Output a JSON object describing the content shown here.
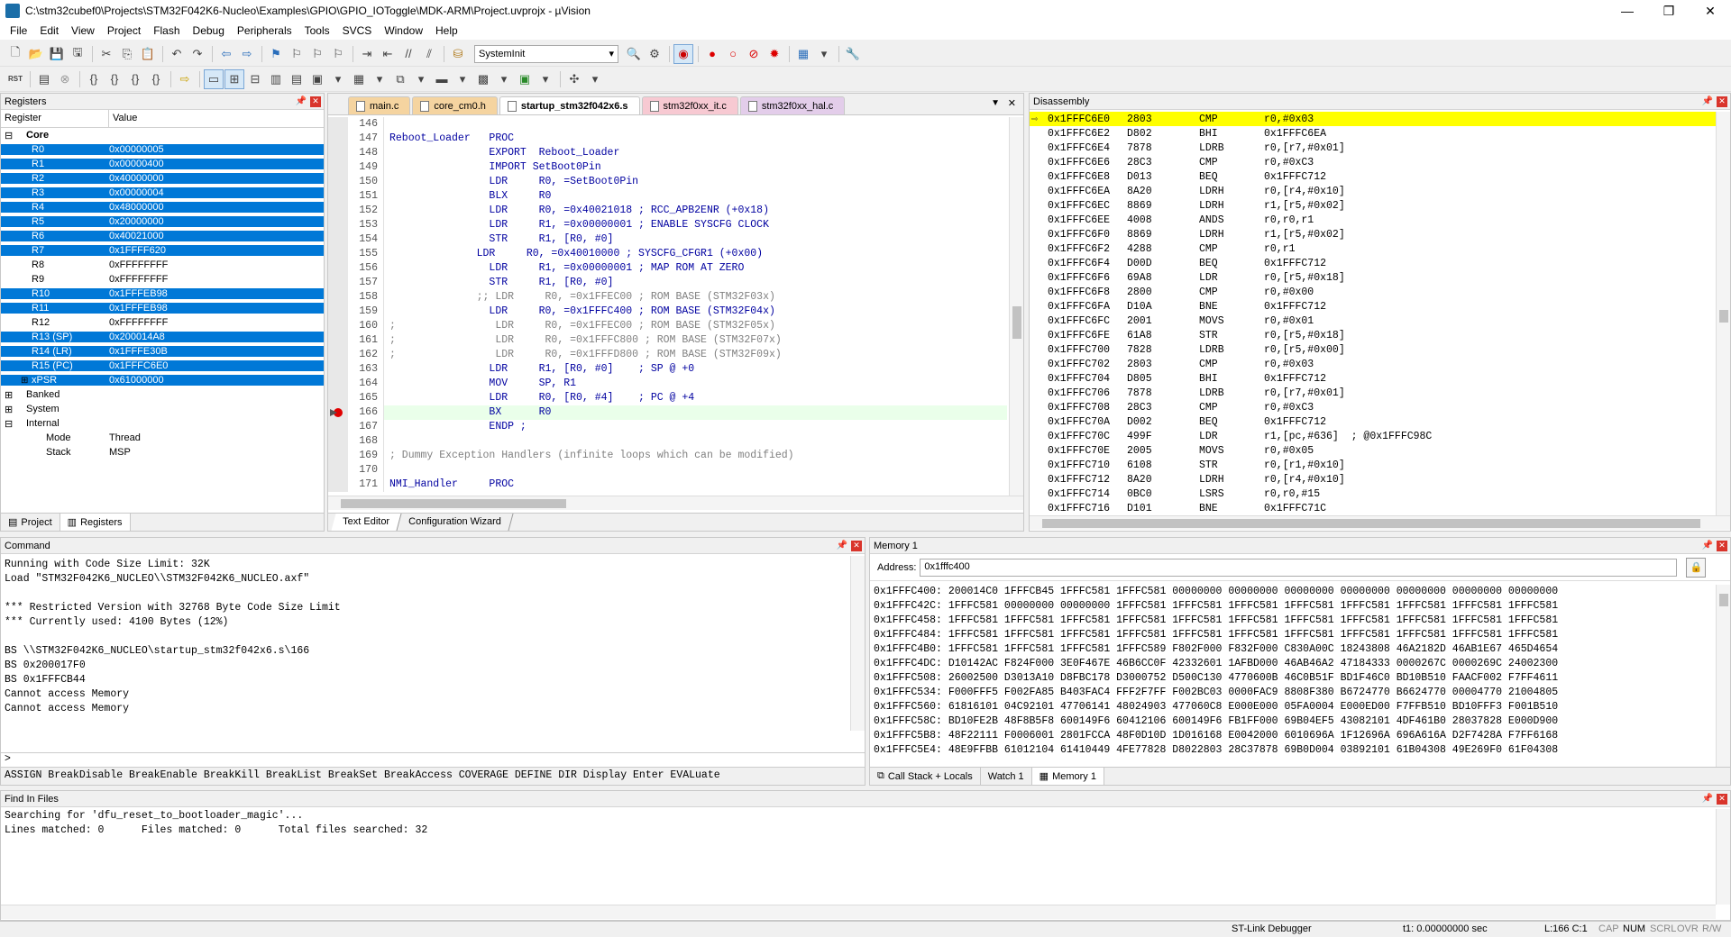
{
  "window": {
    "title": "C:\\stm32cubef0\\Projects\\STM32F042K6-Nucleo\\Examples\\GPIO\\GPIO_IOToggle\\MDK-ARM\\Project.uvprojx - µVision",
    "minimize": "—",
    "maximize": "❐",
    "close": "✕"
  },
  "menu": [
    "File",
    "Edit",
    "View",
    "Project",
    "Flash",
    "Debug",
    "Peripherals",
    "Tools",
    "SVCS",
    "Window",
    "Help"
  ],
  "toolbar": {
    "target_combo": "SystemInit"
  },
  "registers": {
    "title": "Registers",
    "col_register": "Register",
    "col_value": "Value",
    "core_label": "Core",
    "rows": [
      {
        "name": "R0",
        "value": "0x00000005",
        "sel": true
      },
      {
        "name": "R1",
        "value": "0x00000400",
        "sel": true
      },
      {
        "name": "R2",
        "value": "0x40000000",
        "sel": true
      },
      {
        "name": "R3",
        "value": "0x00000004",
        "sel": true
      },
      {
        "name": "R4",
        "value": "0x48000000",
        "sel": true
      },
      {
        "name": "R5",
        "value": "0x20000000",
        "sel": true
      },
      {
        "name": "R6",
        "value": "0x40021000",
        "sel": true
      },
      {
        "name": "R7",
        "value": "0x1FFFF620",
        "sel": true
      },
      {
        "name": "R8",
        "value": "0xFFFFFFFF",
        "sel": false
      },
      {
        "name": "R9",
        "value": "0xFFFFFFFF",
        "sel": false
      },
      {
        "name": "R10",
        "value": "0x1FFFEB98",
        "sel": true
      },
      {
        "name": "R11",
        "value": "0x1FFFEB98",
        "sel": true
      },
      {
        "name": "R12",
        "value": "0xFFFFFFFF",
        "sel": false
      },
      {
        "name": "R13 (SP)",
        "value": "0x200014A8",
        "sel": true
      },
      {
        "name": "R14 (LR)",
        "value": "0x1FFFE30B",
        "sel": true
      },
      {
        "name": "R15 (PC)",
        "value": "0x1FFFC6E0",
        "sel": true
      },
      {
        "name": "xPSR",
        "value": "0x61000000",
        "sel": true
      }
    ],
    "banked": "Banked",
    "system": "System",
    "internal": "Internal",
    "mode_label": "Mode",
    "mode_value": "Thread",
    "stack_label": "Stack",
    "stack_value": "MSP",
    "tab_project": "Project",
    "tab_registers": "Registers"
  },
  "editor": {
    "tabs": [
      {
        "label": "main.c",
        "color": "#f5d4a0",
        "active": false
      },
      {
        "label": "core_cm0.h",
        "color": "#f5d4a0",
        "active": false
      },
      {
        "label": "startup_stm32f042x6.s",
        "color": "#f0f0f0",
        "active": true
      },
      {
        "label": "stm32f0xx_it.c",
        "color": "#f7c9d2",
        "active": false
      },
      {
        "label": "stm32f0xx_hal.c",
        "color": "#e3cdea",
        "active": false
      }
    ],
    "lines": [
      {
        "n": "146",
        "t": ""
      },
      {
        "n": "147",
        "t": "Reboot_Loader   PROC"
      },
      {
        "n": "148",
        "t": "                EXPORT  Reboot_Loader"
      },
      {
        "n": "149",
        "t": "                IMPORT SetBoot0Pin"
      },
      {
        "n": "150",
        "t": "                LDR     R0, =SetBoot0Pin"
      },
      {
        "n": "151",
        "t": "                BLX     R0"
      },
      {
        "n": "152",
        "t": "                LDR     R0, =0x40021018 ; RCC_APB2ENR (+0x18)"
      },
      {
        "n": "153",
        "t": "                LDR     R1, =0x00000001 ; ENABLE SYSCFG CLOCK"
      },
      {
        "n": "154",
        "t": "                STR     R1, [R0, #0]"
      },
      {
        "n": "155",
        "t": "              LDR     R0, =0x40010000 ; SYSCFG_CFGR1 (+0x00)"
      },
      {
        "n": "156",
        "t": "                LDR     R1, =0x00000001 ; MAP ROM AT ZERO"
      },
      {
        "n": "157",
        "t": "                STR     R1, [R0, #0]"
      },
      {
        "n": "158",
        "t": "              ;; LDR     R0, =0x1FFEC00 ; ROM BASE (STM32F03x)"
      },
      {
        "n": "159",
        "t": "                LDR     R0, =0x1FFFC400 ; ROM BASE (STM32F04x)"
      },
      {
        "n": "160",
        "t": ";                LDR     R0, =0x1FFEC00 ; ROM BASE (STM32F05x)"
      },
      {
        "n": "161",
        "t": ";                LDR     R0, =0x1FFFC800 ; ROM BASE (STM32F07x)"
      },
      {
        "n": "162",
        "t": ";                LDR     R0, =0x1FFFD800 ; ROM BASE (STM32F09x)"
      },
      {
        "n": "163",
        "t": "                LDR     R1, [R0, #0]    ; SP @ +0"
      },
      {
        "n": "164",
        "t": "                MOV     SP, R1"
      },
      {
        "n": "165",
        "t": "                LDR     R0, [R0, #4]    ; PC @ +4"
      },
      {
        "n": "166",
        "t": "                BX      R0"
      },
      {
        "n": "167",
        "t": "                ENDP ;"
      },
      {
        "n": "168",
        "t": ""
      },
      {
        "n": "169",
        "t": "; Dummy Exception Handlers (infinite loops which can be modified)"
      },
      {
        "n": "170",
        "t": ""
      },
      {
        "n": "171",
        "t": "NMI_Handler     PROC"
      }
    ],
    "bottom_tab_text": "Text Editor",
    "bottom_tab_wizard": "Configuration Wizard"
  },
  "disassembly": {
    "title": "Disassembly",
    "rows": [
      [
        "0x1FFFC6E0",
        "2803",
        "CMP",
        "r0,#0x03"
      ],
      [
        "0x1FFFC6E2",
        "D802",
        "BHI",
        "0x1FFFC6EA"
      ],
      [
        "0x1FFFC6E4",
        "7878",
        "LDRB",
        "r0,[r7,#0x01]"
      ],
      [
        "0x1FFFC6E6",
        "28C3",
        "CMP",
        "r0,#0xC3"
      ],
      [
        "0x1FFFC6E8",
        "D013",
        "BEQ",
        "0x1FFFC712"
      ],
      [
        "0x1FFFC6EA",
        "8A20",
        "LDRH",
        "r0,[r4,#0x10]"
      ],
      [
        "0x1FFFC6EC",
        "8869",
        "LDRH",
        "r1,[r5,#0x02]"
      ],
      [
        "0x1FFFC6EE",
        "4008",
        "ANDS",
        "r0,r0,r1"
      ],
      [
        "0x1FFFC6F0",
        "8869",
        "LDRH",
        "r1,[r5,#0x02]"
      ],
      [
        "0x1FFFC6F2",
        "4288",
        "CMP",
        "r0,r1"
      ],
      [
        "0x1FFFC6F4",
        "D00D",
        "BEQ",
        "0x1FFFC712"
      ],
      [
        "0x1FFFC6F6",
        "69A8",
        "LDR",
        "r0,[r5,#0x18]"
      ],
      [
        "0x1FFFC6F8",
        "2800",
        "CMP",
        "r0,#0x00"
      ],
      [
        "0x1FFFC6FA",
        "D10A",
        "BNE",
        "0x1FFFC712"
      ],
      [
        "0x1FFFC6FC",
        "2001",
        "MOVS",
        "r0,#0x01"
      ],
      [
        "0x1FFFC6FE",
        "61A8",
        "STR",
        "r0,[r5,#0x18]"
      ],
      [
        "0x1FFFC700",
        "7828",
        "LDRB",
        "r0,[r5,#0x00]"
      ],
      [
        "0x1FFFC702",
        "2803",
        "CMP",
        "r0,#0x03"
      ],
      [
        "0x1FFFC704",
        "D805",
        "BHI",
        "0x1FFFC712"
      ],
      [
        "0x1FFFC706",
        "7878",
        "LDRB",
        "r0,[r7,#0x01]"
      ],
      [
        "0x1FFFC708",
        "28C3",
        "CMP",
        "r0,#0xC3"
      ],
      [
        "0x1FFFC70A",
        "D002",
        "BEQ",
        "0x1FFFC712"
      ],
      [
        "0x1FFFC70C",
        "499F",
        "LDR",
        "r1,[pc,#636]  ; @0x1FFFC98C"
      ],
      [
        "0x1FFFC70E",
        "2005",
        "MOVS",
        "r0,#0x05"
      ],
      [
        "0x1FFFC710",
        "6108",
        "STR",
        "r0,[r1,#0x10]"
      ],
      [
        "0x1FFFC712",
        "8A20",
        "LDRH",
        "r0,[r4,#0x10]"
      ],
      [
        "0x1FFFC714",
        "0BC0",
        "LSRS",
        "r0,r0,#15"
      ],
      [
        "0x1FFFC716",
        "D101",
        "BNE",
        "0x1FFFC71C"
      ]
    ]
  },
  "command": {
    "title": "Command",
    "output": [
      "Running with Code Size Limit: 32K",
      "Load \"STM32F042K6_NUCLEO\\\\STM32F042K6_NUCLEO.axf\"",
      "",
      "*** Restricted Version with 32768 Byte Code Size Limit",
      "*** Currently used: 4100 Bytes (12%)",
      "",
      "BS \\\\STM32F042K6_NUCLEO\\startup_stm32f042x6.s\\166",
      "BS 0x200017F0",
      "BS 0x1FFFCB44",
      "Cannot access Memory",
      "Cannot access Memory"
    ],
    "prompt": ">",
    "help": "ASSIGN BreakDisable BreakEnable BreakKill BreakList BreakSet BreakAccess COVERAGE DEFINE DIR Display Enter EVALuate"
  },
  "memory": {
    "title": "Memory 1",
    "address_label": "Address:",
    "address_value": "0x1fffc400",
    "rows": [
      "0x1FFFC400: 200014C0 1FFFCB45 1FFFC581 1FFFC581 00000000 00000000 00000000 00000000 00000000 00000000 00000000",
      "0x1FFFC42C: 1FFFC581 00000000 00000000 1FFFC581 1FFFC581 1FFFC581 1FFFC581 1FFFC581 1FFFC581 1FFFC581 1FFFC581",
      "0x1FFFC458: 1FFFC581 1FFFC581 1FFFC581 1FFFC581 1FFFC581 1FFFC581 1FFFC581 1FFFC581 1FFFC581 1FFFC581 1FFFC581",
      "0x1FFFC484: 1FFFC581 1FFFC581 1FFFC581 1FFFC581 1FFFC581 1FFFC581 1FFFC581 1FFFC581 1FFFC581 1FFFC581 1FFFC581",
      "0x1FFFC4B0: 1FFFC581 1FFFC581 1FFFC581 1FFFC589 F802F000 F832F000 C830A00C 18243808 46A2182D 46AB1E67 465D4654",
      "0x1FFFC4DC: D10142AC F824F000 3E0F467E 46B6CC0F 42332601 1AFBD000 46AB46A2 47184333 0000267C 0000269C 24002300",
      "0x1FFFC508: 26002500 D3013A10 D8FBC178 D3000752 D500C130 4770600B 46C0B51F BD1F46C0 BD10B510 FAACF002 F7FF4611",
      "0x1FFFC534: F000FFF5 F002FA85 B403FAC4 FFF2F7FF F002BC03 0000FAC9 8808F380 B6724770 B6624770 00004770 21004805",
      "0x1FFFC560: 61816101 04C92101 47706141 48024903 477060C8 E000E000 05FA0004 E000ED00 F7FFB510 BD10FFF3 F001B510",
      "0x1FFFC58C: BD10FE2B 48F8B5F8 600149F6 60412106 600149F6 FB1FF000 69B04EF5 43082101 4DF461B0 28037828 E000D900",
      "0x1FFFC5B8: 48F22111 F0006001 2801FCCA 48F0D10D 1D016168 E0042000 6010696A 1F12696A 696A616A D2F7428A F7FF6168",
      "0x1FFFC5E4: 48E9FFBB 61012104 61410449 4FE77828 D8022803 28C37878 69B0D004 03892101 61B04308 49E269F0 61F04308"
    ],
    "tab_callstack": "Call Stack + Locals",
    "tab_watch": "Watch 1",
    "tab_memory": "Memory 1"
  },
  "find": {
    "title": "Find In Files",
    "output": [
      "Searching for 'dfu_reset_to_bootloader_magic'...",
      "Lines matched: 0      Files matched: 0      Total files searched: 32"
    ]
  },
  "status": {
    "debugger": "ST-Link Debugger",
    "time": "t1: 0.00000000 sec",
    "position": "L:166 C:1",
    "caps": "CAP",
    "num": "NUM",
    "scrl": "SCRL",
    "ovr": "OVR",
    "rw": "R/W"
  }
}
